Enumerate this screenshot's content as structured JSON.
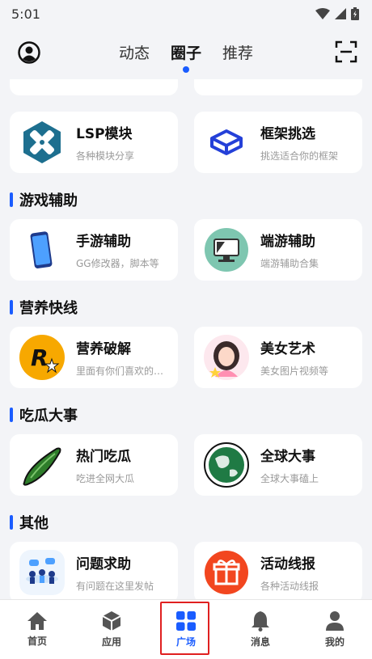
{
  "status": {
    "time": "5:01"
  },
  "header": {
    "tabs": [
      {
        "label": "动态",
        "active": false
      },
      {
        "label": "圈子",
        "active": true
      },
      {
        "label": "推荐",
        "active": false
      }
    ]
  },
  "cards": {
    "lsp": {
      "title": "LSP模块",
      "subtitle": "各种模块分享"
    },
    "frame": {
      "title": "框架挑选",
      "subtitle": "挑选适合你的框架"
    },
    "mobile": {
      "title": "手游辅助",
      "subtitle": "GG修改器，脚本等"
    },
    "pc": {
      "title": "端游辅助",
      "subtitle": "端游辅助合集"
    },
    "crack": {
      "title": "营养破解",
      "subtitle": "里面有你们喜欢的…"
    },
    "art": {
      "title": "美女艺术",
      "subtitle": "美女图片视频等"
    },
    "hot": {
      "title": "热门吃瓜",
      "subtitle": "吃进全网大瓜"
    },
    "global": {
      "title": "全球大事",
      "subtitle": "全球大事磕上"
    },
    "help": {
      "title": "问题求助",
      "subtitle": "有问题在这里发帖"
    },
    "event": {
      "title": "活动线报",
      "subtitle": "各种活动线报"
    }
  },
  "sections": {
    "game": "游戏辅助",
    "nutrition": "营养快线",
    "gossip": "吃瓜大事",
    "other": "其他"
  },
  "bottom_nav": [
    {
      "label": "首页",
      "icon": "home-icon",
      "active": false
    },
    {
      "label": "应用",
      "icon": "apps-cube-icon",
      "active": false
    },
    {
      "label": "广场",
      "icon": "square-grid-icon",
      "active": true
    },
    {
      "label": "消息",
      "icon": "bell-icon",
      "active": false
    },
    {
      "label": "我的",
      "icon": "person-icon",
      "active": false
    }
  ],
  "colors": {
    "accent": "#1a5cff",
    "highlight": "#e02020"
  }
}
